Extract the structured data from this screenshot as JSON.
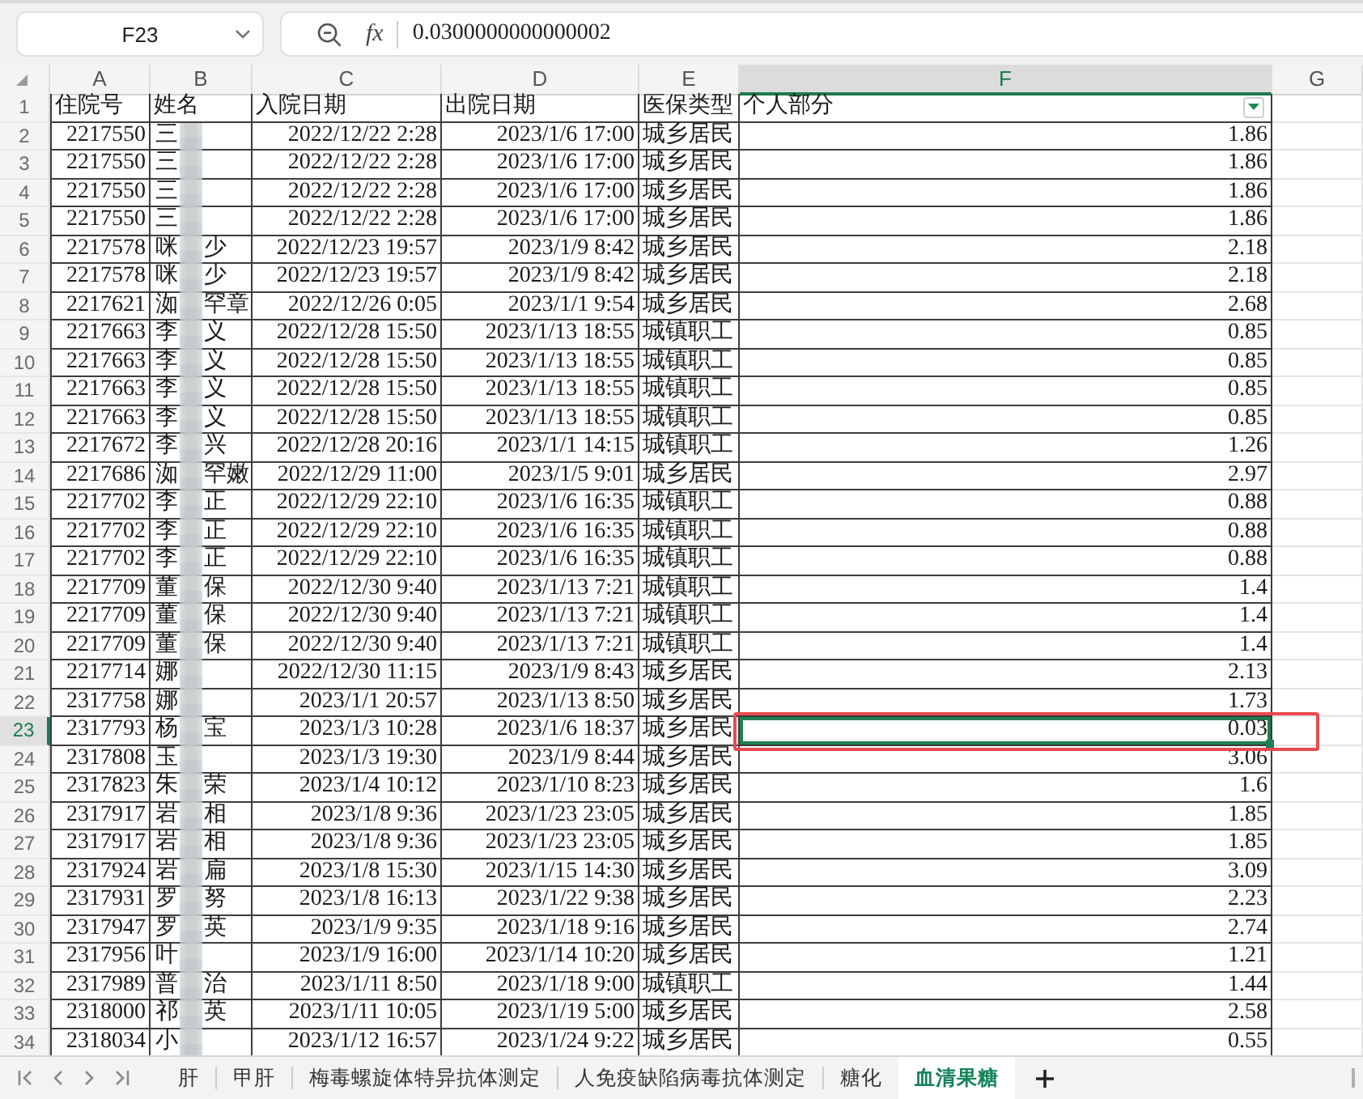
{
  "formula_bar": {
    "name_box": "F23",
    "function_label": "fx",
    "value": "0.0300000000000002"
  },
  "columns": [
    {
      "letter": "A",
      "selected": false
    },
    {
      "letter": "B",
      "selected": false
    },
    {
      "letter": "C",
      "selected": false
    },
    {
      "letter": "D",
      "selected": false
    },
    {
      "letter": "E",
      "selected": false
    },
    {
      "letter": "F",
      "selected": true
    },
    {
      "letter": "G",
      "selected": false
    }
  ],
  "header_row": {
    "number": "1",
    "cells": [
      {
        "text": "住院号",
        "filter": false
      },
      {
        "text": "姓名",
        "filter": false
      },
      {
        "text": "入院日期",
        "filter": false
      },
      {
        "text": "出院日期",
        "filter": false
      },
      {
        "text": "医保类型",
        "filter": false
      },
      {
        "text": "个人部分",
        "filter": true
      }
    ]
  },
  "rows": [
    {
      "number": "2",
      "id": "2217550",
      "name_start": "三",
      "admitted": "2022/12/22 2:28",
      "discharged": "2023/1/6 17:00",
      "insurance": "城乡居民",
      "personal": "1.86",
      "selected": false,
      "highlighted": false
    },
    {
      "number": "3",
      "id": "2217550",
      "name_start": "三",
      "admitted": "2022/12/22 2:28",
      "discharged": "2023/1/6 17:00",
      "insurance": "城乡居民",
      "personal": "1.86",
      "selected": false,
      "highlighted": false
    },
    {
      "number": "4",
      "id": "2217550",
      "name_start": "三",
      "admitted": "2022/12/22 2:28",
      "discharged": "2023/1/6 17:00",
      "insurance": "城乡居民",
      "personal": "1.86",
      "selected": false,
      "highlighted": false
    },
    {
      "number": "5",
      "id": "2217550",
      "name_start": "三",
      "admitted": "2022/12/22 2:28",
      "discharged": "2023/1/6 17:00",
      "insurance": "城乡居民",
      "personal": "1.86",
      "selected": false,
      "highlighted": false
    },
    {
      "number": "6",
      "id": "2217578",
      "name_start": "咪",
      "name_end": "少",
      "admitted": "2022/12/23 19:57",
      "discharged": "2023/1/9 8:42",
      "insurance": "城乡居民",
      "personal": "2.18",
      "selected": false,
      "highlighted": false
    },
    {
      "number": "7",
      "id": "2217578",
      "name_start": "咪",
      "name_end": "少",
      "admitted": "2022/12/23 19:57",
      "discharged": "2023/1/9 8:42",
      "insurance": "城乡居民",
      "personal": "2.18",
      "selected": false,
      "highlighted": false
    },
    {
      "number": "8",
      "id": "2217621",
      "name_start": "洳",
      "name_end": "罕章",
      "admitted": "2022/12/26 0:05",
      "discharged": "2023/1/1 9:54",
      "insurance": "城乡居民",
      "personal": "2.68",
      "selected": false,
      "highlighted": false
    },
    {
      "number": "9",
      "id": "2217663",
      "name_start": "李",
      "name_end": "义",
      "admitted": "2022/12/28 15:50",
      "discharged": "2023/1/13 18:55",
      "insurance": "城镇职工",
      "personal": "0.85",
      "selected": false,
      "highlighted": false
    },
    {
      "number": "10",
      "id": "2217663",
      "name_start": "李",
      "name_end": "义",
      "admitted": "2022/12/28 15:50",
      "discharged": "2023/1/13 18:55",
      "insurance": "城镇职工",
      "personal": "0.85",
      "selected": false,
      "highlighted": false
    },
    {
      "number": "11",
      "id": "2217663",
      "name_start": "李",
      "name_end": "义",
      "admitted": "2022/12/28 15:50",
      "discharged": "2023/1/13 18:55",
      "insurance": "城镇职工",
      "personal": "0.85",
      "selected": false,
      "highlighted": false
    },
    {
      "number": "12",
      "id": "2217663",
      "name_start": "李",
      "name_end": "义",
      "admitted": "2022/12/28 15:50",
      "discharged": "2023/1/13 18:55",
      "insurance": "城镇职工",
      "personal": "0.85",
      "selected": false,
      "highlighted": false
    },
    {
      "number": "13",
      "id": "2217672",
      "name_start": "李",
      "name_end": "兴",
      "admitted": "2022/12/28 20:16",
      "discharged": "2023/1/1 14:15",
      "insurance": "城镇职工",
      "personal": "1.26",
      "selected": false,
      "highlighted": false
    },
    {
      "number": "14",
      "id": "2217686",
      "name_start": "洳",
      "name_end": "罕嫩",
      "admitted": "2022/12/29 11:00",
      "discharged": "2023/1/5 9:01",
      "insurance": "城乡居民",
      "personal": "2.97",
      "selected": false,
      "highlighted": false
    },
    {
      "number": "15",
      "id": "2217702",
      "name_start": "李",
      "name_end": "正",
      "admitted": "2022/12/29 22:10",
      "discharged": "2023/1/6 16:35",
      "insurance": "城镇职工",
      "personal": "0.88",
      "selected": false,
      "highlighted": false
    },
    {
      "number": "16",
      "id": "2217702",
      "name_start": "李",
      "name_end": "正",
      "admitted": "2022/12/29 22:10",
      "discharged": "2023/1/6 16:35",
      "insurance": "城镇职工",
      "personal": "0.88",
      "selected": false,
      "highlighted": false
    },
    {
      "number": "17",
      "id": "2217702",
      "name_start": "李",
      "name_end": "正",
      "admitted": "2022/12/29 22:10",
      "discharged": "2023/1/6 16:35",
      "insurance": "城镇职工",
      "personal": "0.88",
      "selected": false,
      "highlighted": false
    },
    {
      "number": "18",
      "id": "2217709",
      "name_start": "董",
      "name_end": "保",
      "admitted": "2022/12/30 9:40",
      "discharged": "2023/1/13 7:21",
      "insurance": "城镇职工",
      "personal": "1.4",
      "selected": false,
      "highlighted": false
    },
    {
      "number": "19",
      "id": "2217709",
      "name_start": "董",
      "name_end": "保",
      "admitted": "2022/12/30 9:40",
      "discharged": "2023/1/13 7:21",
      "insurance": "城镇职工",
      "personal": "1.4",
      "selected": false,
      "highlighted": false
    },
    {
      "number": "20",
      "id": "2217709",
      "name_start": "董",
      "name_end": "保",
      "admitted": "2022/12/30 9:40",
      "discharged": "2023/1/13 7:21",
      "insurance": "城镇职工",
      "personal": "1.4",
      "selected": false,
      "highlighted": false
    },
    {
      "number": "21",
      "id": "2217714",
      "name_start": "娜",
      "admitted": "2022/12/30 11:15",
      "discharged": "2023/1/9 8:43",
      "insurance": "城乡居民",
      "personal": "2.13",
      "selected": false,
      "highlighted": false
    },
    {
      "number": "22",
      "id": "2317758",
      "name_start": "娜",
      "admitted": "2023/1/1 20:57",
      "discharged": "2023/1/13 8:50",
      "insurance": "城乡居民",
      "personal": "1.73",
      "selected": false,
      "highlighted": false
    },
    {
      "number": "23",
      "id": "2317793",
      "name_start": "杨",
      "name_end": "宝",
      "admitted": "2023/1/3 10:28",
      "discharged": "2023/1/6 18:37",
      "insurance": "城乡居民",
      "personal": "0.03",
      "selected": true,
      "highlighted": true
    },
    {
      "number": "24",
      "id": "2317808",
      "name_start": "玉",
      "admitted": "2023/1/3 19:30",
      "discharged": "2023/1/9 8:44",
      "insurance": "城乡居民",
      "personal": "3.06",
      "selected": false,
      "highlighted": false
    },
    {
      "number": "25",
      "id": "2317823",
      "name_start": "朱",
      "name_end": "荣",
      "admitted": "2023/1/4 10:12",
      "discharged": "2023/1/10 8:23",
      "insurance": "城乡居民",
      "personal": "1.6",
      "selected": false,
      "highlighted": false
    },
    {
      "number": "26",
      "id": "2317917",
      "name_start": "岩",
      "name_end": "相",
      "admitted": "2023/1/8 9:36",
      "discharged": "2023/1/23 23:05",
      "insurance": "城乡居民",
      "personal": "1.85",
      "selected": false,
      "highlighted": false
    },
    {
      "number": "27",
      "id": "2317917",
      "name_start": "岩",
      "name_end": "相",
      "admitted": "2023/1/8 9:36",
      "discharged": "2023/1/23 23:05",
      "insurance": "城乡居民",
      "personal": "1.85",
      "selected": false,
      "highlighted": false
    },
    {
      "number": "28",
      "id": "2317924",
      "name_start": "岩",
      "name_end": "扁",
      "admitted": "2023/1/8 15:30",
      "discharged": "2023/1/15 14:30",
      "insurance": "城乡居民",
      "personal": "3.09",
      "selected": false,
      "highlighted": false
    },
    {
      "number": "29",
      "id": "2317931",
      "name_start": "罗",
      "name_end": "努",
      "admitted": "2023/1/8 16:13",
      "discharged": "2023/1/22 9:38",
      "insurance": "城乡居民",
      "personal": "2.23",
      "selected": false,
      "highlighted": false
    },
    {
      "number": "30",
      "id": "2317947",
      "name_start": "罗",
      "name_end": "英",
      "admitted": "2023/1/9 9:35",
      "discharged": "2023/1/18 9:16",
      "insurance": "城乡居民",
      "personal": "2.74",
      "selected": false,
      "highlighted": false
    },
    {
      "number": "31",
      "id": "2317956",
      "name_start": "叶",
      "admitted": "2023/1/9 16:00",
      "discharged": "2023/1/14 10:20",
      "insurance": "城乡居民",
      "personal": "1.21",
      "selected": false,
      "highlighted": false
    },
    {
      "number": "32",
      "id": "2317989",
      "name_start": "普",
      "name_end": "治",
      "admitted": "2023/1/11 8:50",
      "discharged": "2023/1/18 9:00",
      "insurance": "城镇职工",
      "personal": "1.44",
      "selected": false,
      "highlighted": false
    },
    {
      "number": "33",
      "id": "2318000",
      "name_start": "祁",
      "name_end": "英",
      "admitted": "2023/1/11 10:05",
      "discharged": "2023/1/19 5:00",
      "insurance": "城乡居民",
      "personal": "2.58",
      "selected": false,
      "highlighted": false
    },
    {
      "number": "34",
      "id": "2318034",
      "name_start": "小",
      "admitted": "2023/1/12 16:57",
      "discharged": "2023/1/24 9:22",
      "insurance": "城乡居民",
      "personal": "0.55",
      "selected": false,
      "highlighted": false
    }
  ],
  "sheet_tabs": [
    {
      "label": "肝",
      "selected": false
    },
    {
      "label": "甲肝",
      "selected": false
    },
    {
      "label": "梅毒螺旋体特异抗体测定",
      "selected": false
    },
    {
      "label": "人免疫缺陷病毒抗体测定",
      "selected": false
    },
    {
      "label": "糖化",
      "selected": false
    },
    {
      "label": "血清果糖",
      "selected": true
    }
  ]
}
